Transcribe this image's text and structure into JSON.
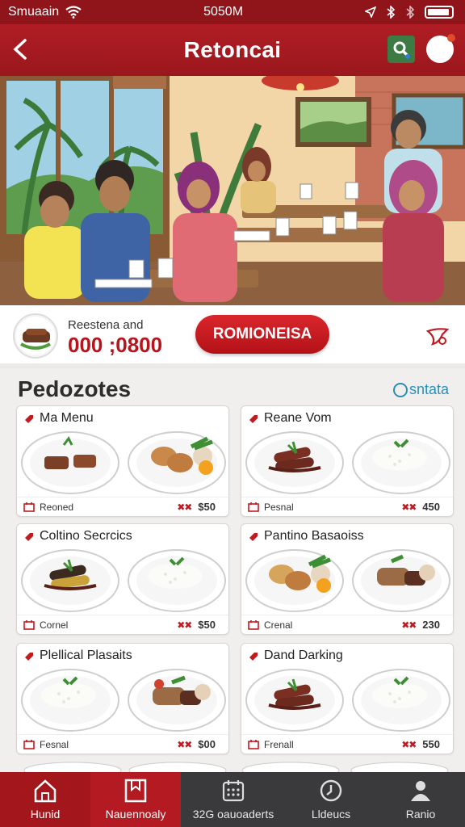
{
  "status": {
    "carrier": "Smuaain",
    "time": "5050M"
  },
  "appbar": {
    "title": "Retoncai"
  },
  "promo": {
    "sub": "Reestena and",
    "number": "000 ;0800",
    "cta": "ROMIONEISA"
  },
  "section": {
    "heading": "Pedozotes",
    "see_all": "sntata"
  },
  "cards": [
    {
      "name": "Ma Menu",
      "tag": "Reoned",
      "price": "$50"
    },
    {
      "name": "Reane Vom",
      "tag": "Pesnal",
      "price": "450"
    },
    {
      "name": "Coltino Secrcics",
      "tag": "Cornel",
      "price": "$50"
    },
    {
      "name": "Pantino Basaoiss",
      "tag": "Crenal",
      "price": "230"
    },
    {
      "name": "Plellical Plasaits",
      "tag": "Fesnal",
      "price": "$00"
    },
    {
      "name": "Dand Darking",
      "tag": "Frenall",
      "price": "550"
    }
  ],
  "tabs": [
    {
      "label": "Hunid",
      "icon": "home-icon"
    },
    {
      "label": "Nauennoaly",
      "icon": "bookmark-icon"
    },
    {
      "label": "32G oauoaderts",
      "icon": "calendar-icon"
    },
    {
      "label": "Lldeucs",
      "icon": "clock-icon"
    },
    {
      "label": "Ranio",
      "icon": "person-icon"
    }
  ],
  "colors": {
    "brand": "#a3161c",
    "cta": "#d9262c",
    "accent_link": "#2a8fb8",
    "tabbar_dark": "#3a3a3c"
  }
}
